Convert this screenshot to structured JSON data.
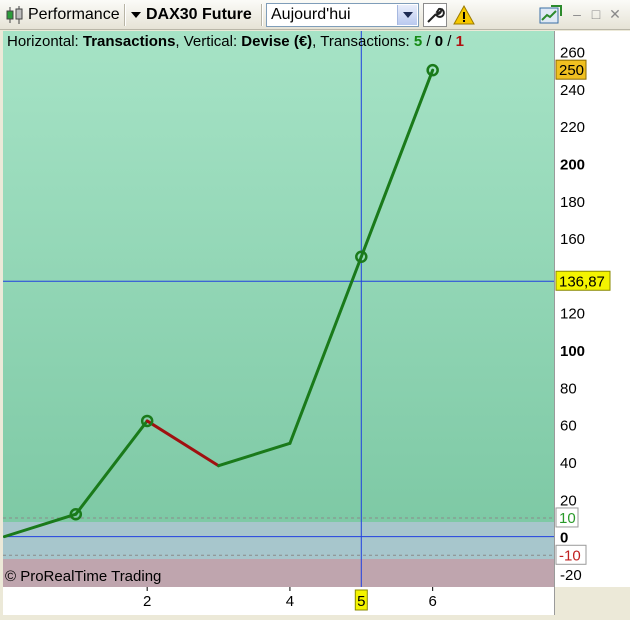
{
  "toolbar": {
    "performance_label": "Performance",
    "instrument_label": "DAX30 Future",
    "period_value": "Aujourd'hui",
    "icons": [
      "candlestick-icon",
      "dropdown-arrow-icon",
      "wrench-icon",
      "warning-icon",
      "export-chart-icon",
      "minimize-icon",
      "maximize-icon",
      "close-icon"
    ]
  },
  "header": {
    "horizontal_label": "Horizontal: ",
    "horizontal_value": "Transactions",
    "vertical_label": ", Vertical: ",
    "vertical_value": "Devise (€)",
    "transactions_label": ", Transactions: ",
    "wins": "5",
    "sep1": " / ",
    "neutral": "0",
    "sep2": " / ",
    "losses": "1"
  },
  "copyright": "© ProRealTime Trading",
  "chart_data": {
    "type": "line",
    "x": [
      0,
      1,
      2,
      3,
      4,
      5,
      6
    ],
    "y": [
      0,
      12,
      62,
      38,
      50,
      150,
      250
    ],
    "segment_colors": [
      "#1a7a1a",
      "#1a7a1a",
      "#a01010",
      "#1a7a1a",
      "#1a7a1a",
      "#1a7a1a"
    ],
    "markers_x": [
      1,
      2,
      5,
      6
    ],
    "xlim": [
      -0.02,
      7.7
    ],
    "ylim": [
      -27,
      271
    ],
    "y_ticks": [
      -20,
      20,
      40,
      60,
      80,
      100,
      120,
      140,
      160,
      180,
      200,
      220,
      240,
      260
    ],
    "y_bold_ticks": [
      100,
      200,
      0
    ],
    "zero_label": "0",
    "x_ticks": [
      2,
      4,
      6
    ],
    "threshold_upper": 10,
    "threshold_lower": -10,
    "threshold_upper_label": "10",
    "threshold_lower_label": "-10",
    "last_value_label": "250",
    "last_value": 250,
    "crosshair_y": 136.87,
    "crosshair_y_label": "136,87",
    "crosshair_x": 5,
    "crosshair_x_label": "5",
    "colors": {
      "line": "#1a7a1a",
      "loss": "#a01010",
      "crosshair": "#2040e0",
      "label_bg": "#f4f400",
      "last_bg": "#f0c020"
    }
  }
}
